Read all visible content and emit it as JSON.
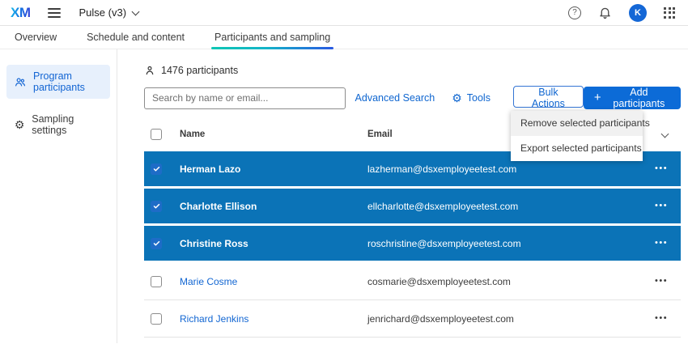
{
  "header": {
    "logo": "XM",
    "program_name": "Pulse (v3)",
    "avatar_initial": "K"
  },
  "tabs": [
    {
      "label": "Overview"
    },
    {
      "label": "Schedule and content"
    },
    {
      "label": "Participants and sampling"
    }
  ],
  "active_tab": "Participants and sampling",
  "sidebar": {
    "items": [
      {
        "label": "Program participants",
        "icon": "people-icon",
        "active": true
      },
      {
        "label": "Sampling settings",
        "icon": "gear-icon",
        "active": false
      }
    ]
  },
  "main": {
    "participants_count": "1476 participants",
    "search_placeholder": "Search by name or email...",
    "advanced_search_label": "Advanced Search",
    "tools_label": "Tools",
    "bulk_actions_label": "Bulk Actions",
    "add_participants_label": "Add participants",
    "bulk_menu": {
      "items": [
        "Remove selected participants",
        "Export selected participants"
      ],
      "highlighted": "Remove selected participants"
    },
    "table": {
      "columns": [
        "Name",
        "Email"
      ],
      "rows": [
        {
          "name": "Herman Lazo",
          "email": "lazherman@dsxemployeetest.com",
          "selected": true
        },
        {
          "name": "Charlotte Ellison",
          "email": "ellcharlotte@dsxemployeetest.com",
          "selected": true
        },
        {
          "name": "Christine Ross",
          "email": "roschristine@dsxemployeetest.com",
          "selected": true
        },
        {
          "name": "Marie Cosme",
          "email": "cosmarie@dsxemployeetest.com",
          "selected": false
        },
        {
          "name": "Richard Jenkins",
          "email": "jenrichard@dsxemployeetest.com",
          "selected": false
        }
      ]
    }
  },
  "icons": {
    "help_glyph": "?",
    "gear": "⚙",
    "plus": "+",
    "ellipsis": "•••"
  },
  "colors": {
    "selected_row_blue": "#0B73B7",
    "primary_button_blue": "#0C6BD7",
    "link_blue": "#0F66D0",
    "active_nav_bg": "#E7F0FC",
    "avatar_blue": "#1467D6",
    "tab_underline_gradient_start": "#0FC7B4",
    "tab_underline_gradient_end": "#2A59E2"
  }
}
